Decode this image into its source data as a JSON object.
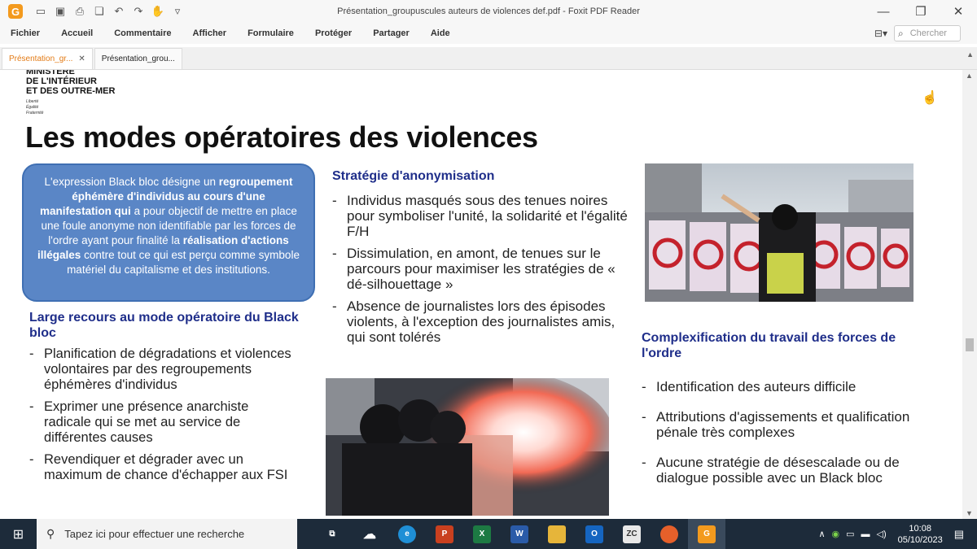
{
  "window": {
    "title": "Présentation_groupuscules auteurs de violences def.pdf - Foxit PDF Reader",
    "minimize": "—",
    "restore": "❐",
    "close": "✕"
  },
  "menu": {
    "items": [
      "Fichier",
      "Accueil",
      "Commentaire",
      "Afficher",
      "Formulaire",
      "Protéger",
      "Partager",
      "Aide"
    ],
    "search_placeholder": "Chercher"
  },
  "tabs": [
    {
      "label": "Présentation_gr...",
      "active": true,
      "close": "✕"
    },
    {
      "label": "Présentation_grou...",
      "active": false
    }
  ],
  "slide": {
    "ministry_lines": [
      "MINISTÈRE",
      "DE L'INTÉRIEUR",
      "ET DES OUTRE-MER"
    ],
    "motto_lines": [
      "Liberté",
      "Égalité",
      "Fraternité"
    ],
    "title": "Les modes opératoires des violences",
    "box": {
      "t1": "L'expression Black bloc désigne un",
      "t2": "regroupement éphémère d'individus au cours d'une manifestation qui",
      "t3": " a pour objectif de mettre en place une foule anonyme non identifiable par les forces de l'ordre ayant pour finalité la ",
      "t4": "réalisation d'actions illégales",
      "t5": " contre tout ce qui est perçu comme symbole matériel du capitalisme et des institutions."
    },
    "left": {
      "heading": "Large recours au mode opératoire du Black bloc",
      "bullets": [
        "Planification de dégradations et violences volontaires par des regroupements éphémères d'individus",
        "Exprimer une présence anarchiste radicale qui se met au service de différentes causes",
        "Revendiquer et dégrader avec un maximum de chance d'échapper aux FSI"
      ]
    },
    "middle": {
      "heading": "Stratégie d'anonymisation",
      "bullets": [
        "Individus masqués sous des tenues noires pour symboliser l'unité, la solidarité et l'égalité F/H",
        "Dissimulation, en amont, de tenues sur le parcours pour maximiser les stratégies de « dé-silhouettage »",
        "Absence de journalistes lors des épisodes violents, à l'exception des journalistes amis, qui sont tolérés"
      ]
    },
    "right": {
      "heading": "Complexification du travail des forces de l'ordre",
      "bullets": [
        "Identification des auteurs difficile",
        "Attributions d'agissements et qualification pénale très complexes",
        "Aucune stratégie de désescalade ou de dialogue possible avec un Black bloc"
      ]
    }
  },
  "taskbar": {
    "search_placeholder": "Tapez ici pour effectuer une recherche",
    "time": "10:08",
    "date": "05/10/2023"
  }
}
